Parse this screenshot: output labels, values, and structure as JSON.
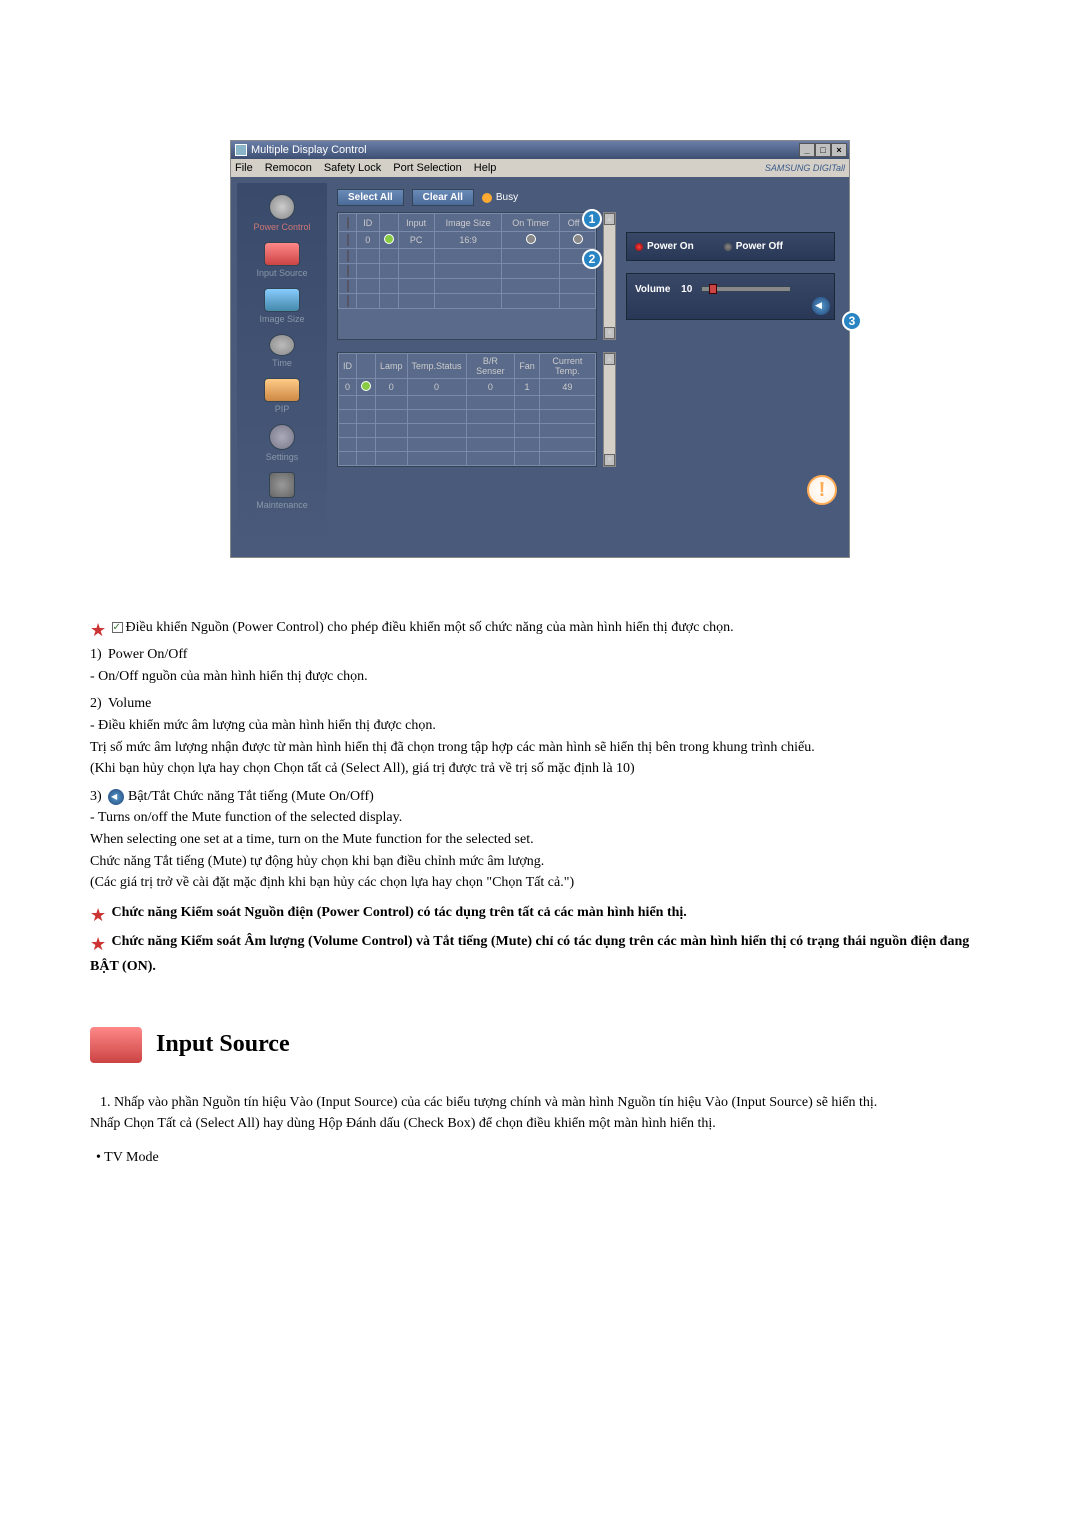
{
  "window": {
    "title": "Multiple Display Control",
    "menu": [
      "File",
      "Remocon",
      "Safety Lock",
      "Port Selection",
      "Help"
    ],
    "brand": "SAMSUNG DIGITall"
  },
  "sidebar": {
    "items": [
      {
        "label": "Power Control"
      },
      {
        "label": "Input Source"
      },
      {
        "label": "Image Size"
      },
      {
        "label": "Time"
      },
      {
        "label": "PIP"
      },
      {
        "label": "Settings"
      },
      {
        "label": "Maintenance"
      }
    ]
  },
  "buttons": {
    "select_all": "Select All",
    "clear_all": "Clear All",
    "busy": "Busy",
    "power_on": "Power On",
    "power_off": "Power Off"
  },
  "volume": {
    "label": "Volume",
    "value": "10"
  },
  "table1": {
    "headers": [
      "",
      "ID",
      "",
      "Input",
      "Image Size",
      "On Timer",
      "Off T"
    ],
    "rows": [
      [
        "",
        "0",
        "",
        "PC",
        "16:9",
        "",
        ""
      ]
    ]
  },
  "table2": {
    "headers": [
      "ID",
      "",
      "Lamp",
      "Temp.Status",
      "B/R Senser",
      "Fan",
      "Current Temp."
    ],
    "rows": [
      [
        "0",
        "",
        "0",
        "0",
        "0",
        "1",
        "49"
      ]
    ]
  },
  "callouts": {
    "c1": "1",
    "c2": "2",
    "c3": "3"
  },
  "doc": {
    "intro": "Điều khiển Nguồn (Power Control) cho phép điều khiển một số chức năng của màn hình hiển thị được chọn.",
    "item1_num": "1)",
    "item1_title": "Power On/Off",
    "item1_l1": "- On/Off nguồn của màn hình hiển thị được chọn.",
    "item2_num": "2)",
    "item2_title": "Volume",
    "item2_l1": "- Điều khiển mức âm lượng của màn hình hiển thị được chọn.",
    "item2_l2": "Trị số mức âm lượng nhận được từ màn hình hiển thị đã chọn trong tập hợp các màn hình sẽ hiển thị bên trong khung trình chiếu.",
    "item2_l3": "(Khi bạn hủy chọn lựa hay chọn Chọn tất cả (Select All), giá trị được trả về trị số mặc định là 10)",
    "item3_num": "3)",
    "item3_title": "Bật/Tắt Chức năng Tắt tiếng (Mute On/Off)",
    "item3_l1": "- Turns on/off the Mute function of the selected display.",
    "item3_l2": "When selecting one set at a time, turn on the Mute function for the selected set.",
    "item3_l3": "Chức năng Tắt tiếng (Mute) tự động hủy chọn khi bạn điều chỉnh mức âm lượng.",
    "item3_l4": "(Các giá trị trở về cài đặt mặc định khi bạn hủy các chọn lựa hay chọn \"Chọn Tất cả.\")",
    "note1": "Chức năng Kiểm soát Nguồn điện (Power Control) có tác dụng trên tất cả các màn hình hiển thị.",
    "note2": "Chức năng Kiểm soát Âm lượng (Volume Control) và Tắt tiếng (Mute) chỉ có tác dụng trên các màn hình hiển thị có trạng thái nguồn điện đang BẬT (ON).",
    "section_title": "Input Source",
    "s1_num": "1.",
    "s1_text": "Nhấp vào phần Nguồn tín hiệu Vào (Input Source) của các biểu tượng chính và màn hình Nguồn tín hiệu Vào (Input Source) sẽ hiển thị.",
    "s1_text2": "Nhấp Chọn Tất cả (Select All) hay dùng Hộp Đánh dấu (Check Box) để chọn điều khiển một màn hình hiển thị.",
    "tvmode": "• TV Mode"
  }
}
